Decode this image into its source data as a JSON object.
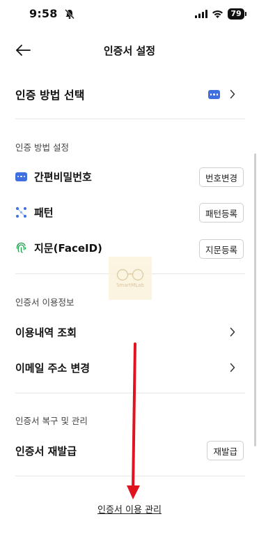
{
  "status_bar": {
    "time": "9:58",
    "battery": "79"
  },
  "header": {
    "title": "인증서 설정"
  },
  "auth_method": {
    "label": "인증 방법 선택"
  },
  "method_settings": {
    "section_title": "인증 방법 설정",
    "items": [
      {
        "label": "간편비밀번호",
        "button": "번호변경",
        "icon": "pin-dots-icon"
      },
      {
        "label": "패턴",
        "button": "패턴등록",
        "icon": "pattern-icon"
      },
      {
        "label": "지문(FaceID)",
        "button": "지문등록",
        "icon": "fingerprint-icon"
      }
    ]
  },
  "usage_info": {
    "section_title": "인증서 이용정보",
    "items": [
      {
        "label": "이용내역 조회"
      },
      {
        "label": "이메일 주소 변경"
      }
    ]
  },
  "recovery": {
    "section_title": "인증서 복구 및 관리",
    "reissue_label": "인증서 재발급",
    "reissue_button": "재발급"
  },
  "watermark": {
    "text": "SmartMLab"
  },
  "footer": {
    "link": "인증서 이용 관리"
  },
  "colors": {
    "accent": "#3f6fe0",
    "arrow": "#e0141e",
    "divider": "#e6e6e6"
  }
}
